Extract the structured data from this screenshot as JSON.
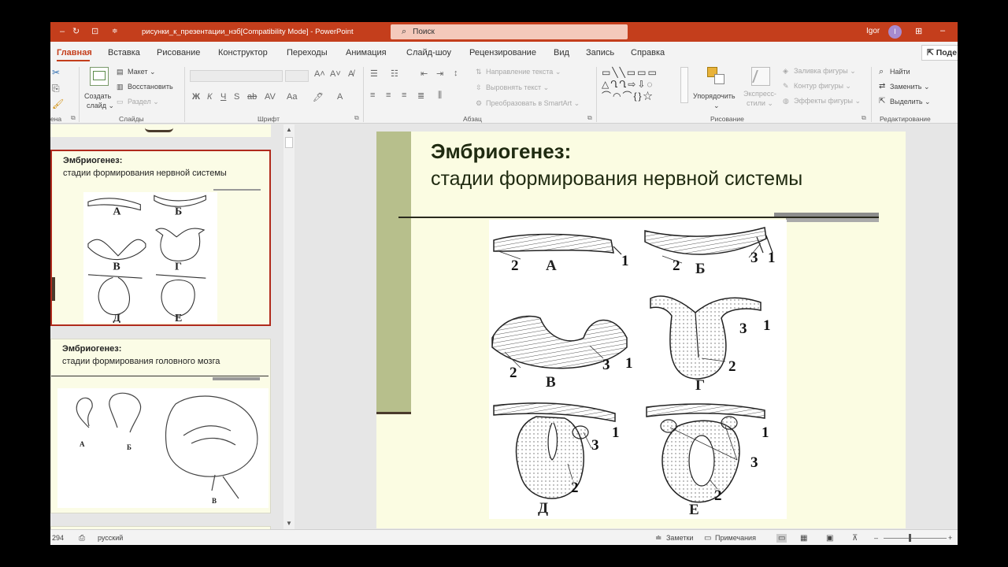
{
  "titlebar": {
    "doc_title": "рисунки_к_презентации_нзб[Compatibility Mode]  -  PowerPoint",
    "search_placeholder": "Поиск",
    "user_name": "Igor",
    "avatar_initial": "I"
  },
  "tabs": [
    {
      "label": "Главная",
      "active": true
    },
    {
      "label": "Вставка"
    },
    {
      "label": "Рисование"
    },
    {
      "label": "Конструктор"
    },
    {
      "label": "Переходы"
    },
    {
      "label": "Анимация"
    },
    {
      "label": "Слайд-шоу"
    },
    {
      "label": "Рецензирование"
    },
    {
      "label": "Вид"
    },
    {
      "label": "Запись"
    },
    {
      "label": "Справка"
    }
  ],
  "share_label": "Поде",
  "ribbon": {
    "slides": {
      "create_label_1": "Создать",
      "create_label_2": "слайд ⌄",
      "layout": "Макет ⌄",
      "reset": "Восстановить",
      "section": "Раздел ⌄",
      "group": "Слайды"
    },
    "clipboard_group": "ена",
    "font": {
      "group": "Шрифт"
    },
    "paragraph": {
      "text_direction": "Направление текста ⌄",
      "align_text": "Выровнять текст ⌄",
      "smartart": "Преобразовать в SmartArt ⌄",
      "group": "Абзац"
    },
    "drawing": {
      "arrange_1": "Упорядочить",
      "arrange_2": "⌄",
      "styles_1": "Экспресс-",
      "styles_2": "стили ⌄",
      "fill": "Заливка фигуры ⌄",
      "outline": "Контур фигуры ⌄",
      "effects": "Эффекты фигуры ⌄",
      "group": "Рисование"
    },
    "editing": {
      "find": "Найти",
      "replace": "Заменить ⌄",
      "select": "Выделить ⌄",
      "group": "Редактирование"
    }
  },
  "thumbnails": [
    {
      "title": "Эмбриогенез:",
      "subtitle": "стадии формирования нервной системы",
      "selected": true,
      "labels": [
        "А",
        "Б",
        "В",
        "Г",
        "Д",
        "Е"
      ]
    },
    {
      "title": "Эмбриогенез:",
      "subtitle": "стадии формирования головного мозга",
      "selected": false,
      "labels": [
        "А",
        "Б",
        "В"
      ]
    }
  ],
  "slide": {
    "title": "Эмбриогенез:",
    "subtitle": "стадии формирования нервной системы",
    "figure_labels": [
      "А",
      "Б",
      "В",
      "Г",
      "Д",
      "Е"
    ],
    "numbers": [
      "1",
      "2",
      "3"
    ]
  },
  "statusbar": {
    "slide_count": "294",
    "language": "русский",
    "notes": "Заметки",
    "comments": "Примечания"
  },
  "colors": {
    "accent": "#c43e1c",
    "slide_bg": "#fbfce2",
    "slide_bar": "#b7bf8c"
  }
}
